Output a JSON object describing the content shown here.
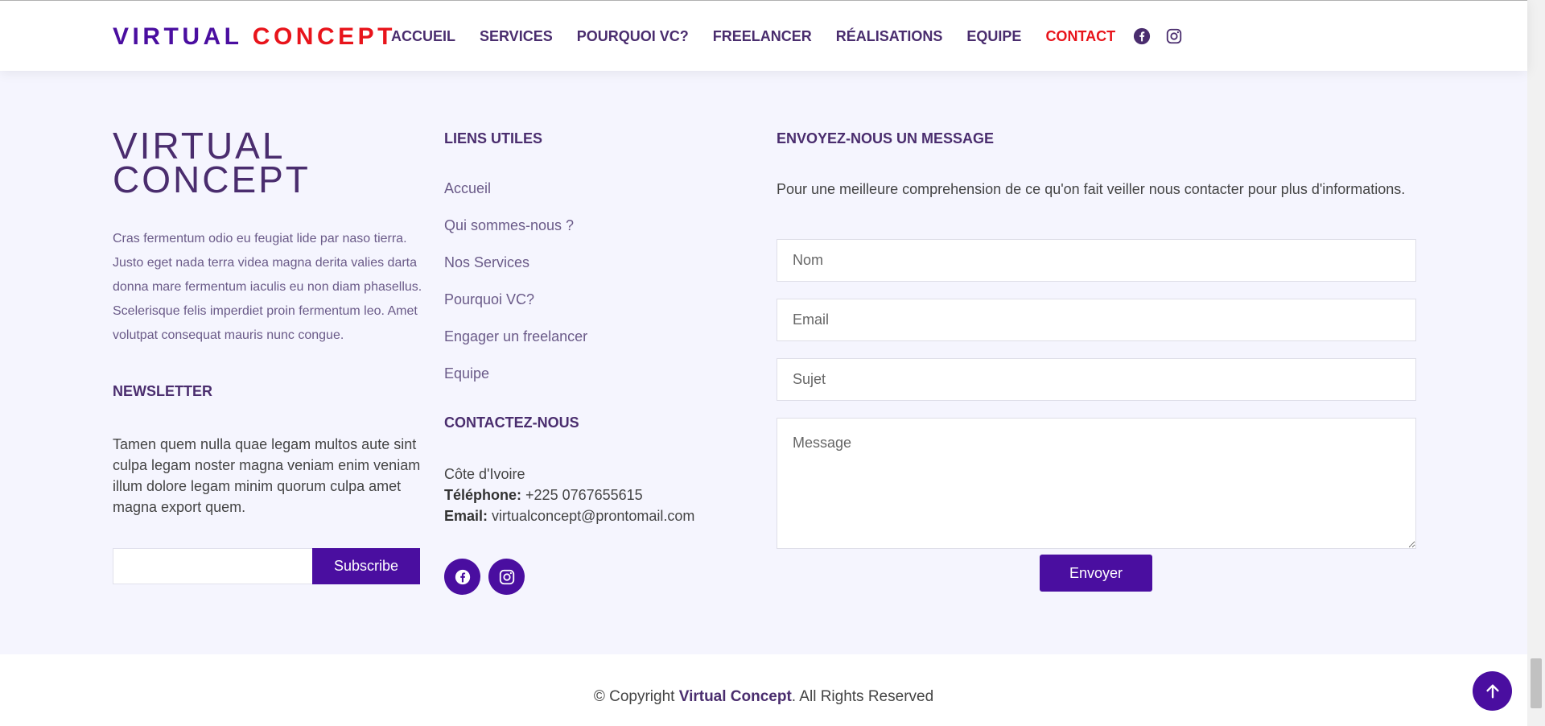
{
  "header": {
    "logo_part1": "VIRTUAL",
    "logo_part2": "CONCEPT",
    "nav": [
      {
        "label": "ACCUEIL"
      },
      {
        "label": "SERVICES"
      },
      {
        "label": "POURQUOI VC?"
      },
      {
        "label": "FREELANCER"
      },
      {
        "label": "RÉALISATIONS"
      },
      {
        "label": "EQUIPE"
      },
      {
        "label": "CONTACT",
        "active": true
      }
    ],
    "social_icons": [
      "facebook-icon",
      "instagram-icon"
    ]
  },
  "about": {
    "brand_line1": "VIRTUAL",
    "brand_line2": "CONCEPT",
    "text": "Cras fermentum odio eu feugiat lide par naso tierra. Justo eget nada terra videa magna derita valies darta donna mare fermentum iaculis eu non diam phasellus. Scelerisque felis imperdiet proin fermentum leo. Amet volutpat consequat mauris nunc congue."
  },
  "newsletter": {
    "title": "NEWSLETTER",
    "text": "Tamen quem nulla quae legam multos aute sint culpa legam noster magna veniam enim veniam illum dolore legam minim quorum culpa amet magna export quem.",
    "input_value": "",
    "button": "Subscribe"
  },
  "links": {
    "title": "LIENS UTILES",
    "items": [
      "Accueil",
      "Qui sommes-nous ?",
      "Nos Services",
      "Pourquoi VC?",
      "Engager un freelancer",
      "Equipe"
    ]
  },
  "contact": {
    "title": "CONTACTEZ-NOUS",
    "location": "Côte d'Ivoire",
    "phone_label": "Téléphone:",
    "phone": "+225 0767655615",
    "email_label": "Email:",
    "email": "virtualconcept@prontomail.com",
    "social_icons": [
      "facebook-icon",
      "instagram-icon"
    ]
  },
  "message_form": {
    "title": "ENVOYEZ-NOUS UN MESSAGE",
    "intro": "Pour une meilleure comprehension de ce qu'on fait veiller nous contacter pour plus d'informations.",
    "name_placeholder": "Nom",
    "email_placeholder": "Email",
    "subject_placeholder": "Sujet",
    "message_placeholder": "Message",
    "submit": "Envoyer"
  },
  "footer": {
    "copyright_prefix": "© Copyright",
    "company": "Virtual Concept",
    "copyright_suffix": ". All Rights Reserved"
  },
  "colors": {
    "primary": "#4a0ea0",
    "accent_red": "#e8141b",
    "heading": "#4a2d6e",
    "background": "#f5f5fe"
  }
}
